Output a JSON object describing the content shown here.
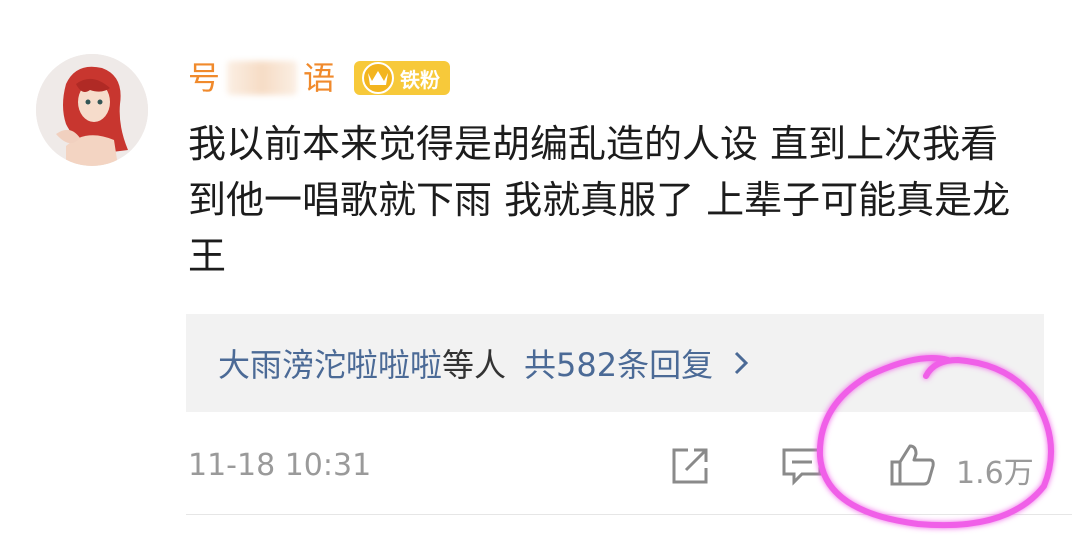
{
  "user": {
    "name_visible_start": "号",
    "name_visible_end": "语",
    "badge_label": "铁粉"
  },
  "comment": {
    "text": "我以前本来觉得是胡编乱造的人设 直到上次我看到他一唱歌就下雨 我就真服了 上辈子可能真是龙王"
  },
  "replies": {
    "names": "大雨滂沱啦啦啦",
    "others": "等人",
    "count_label": "共582条回复",
    "chevron_icon": "chevron-right-icon"
  },
  "footer": {
    "timestamp": "11-18 10:31",
    "share_icon": "share-icon",
    "comment_icon": "comment-icon",
    "like_icon": "thumbs-up-icon",
    "like_count": "1.6万"
  },
  "colors": {
    "username": "#f08a2c",
    "badge": "#f7c93a",
    "link": "#4b6a96",
    "meta": "#9a9a9a",
    "highlight": "#f05ee8"
  }
}
